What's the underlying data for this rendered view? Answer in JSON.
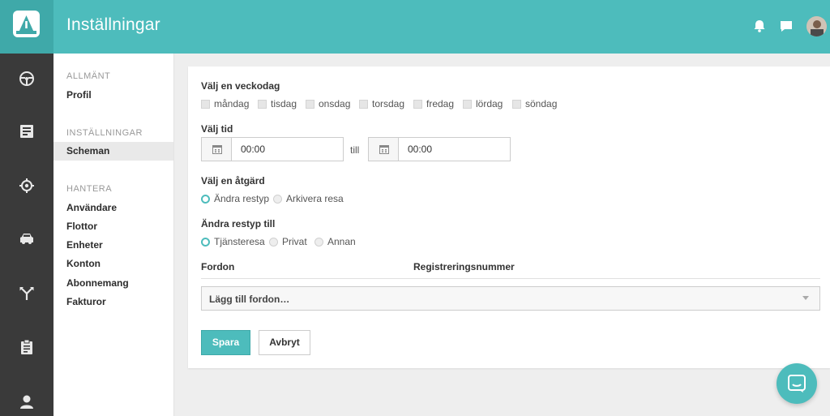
{
  "header": {
    "title": "Inställningar",
    "icons": [
      "bell-icon",
      "chat-icon"
    ],
    "accent_color": "#4dbcbc"
  },
  "rail": {
    "icons": [
      "steering-wheel-icon",
      "trip-list-icon",
      "location-icon",
      "car-icon",
      "route-split-icon",
      "clipboard-icon",
      "person-icon"
    ]
  },
  "subnav": {
    "sections": [
      {
        "heading": "ALLMÄNT",
        "items": [
          "Profil"
        ]
      },
      {
        "heading": "INSTÄLLNINGAR",
        "items": [
          "Scheman"
        ]
      },
      {
        "heading": "HANTERA",
        "items": [
          "Användare",
          "Flottor",
          "Enheter",
          "Konton",
          "Abonnemang",
          "Fakturor"
        ]
      }
    ],
    "active_item": "Scheman"
  },
  "form": {
    "weekday_label": "Välj en veckodag",
    "weekdays": [
      "måndag",
      "tisdag",
      "onsdag",
      "torsdag",
      "fredag",
      "lördag",
      "söndag"
    ],
    "time_label": "Välj tid",
    "time_from": "00:00",
    "time_sep": "till",
    "time_to": "00:00",
    "action_label": "Välj en åtgärd",
    "actions": [
      "Ändra restyp",
      "Arkivera resa"
    ],
    "action_selected": "Ändra restyp",
    "triptype_label": "Ändra restyp till",
    "triptypes": [
      "Tjänsteresa",
      "Privat",
      "Annan"
    ],
    "triptype_selected": "Tjänsteresa",
    "col_vehicle": "Fordon",
    "col_reg": "Registreringsnummer",
    "vehicle_select": "Lägg till fordon…",
    "save_label": "Spara",
    "cancel_label": "Avbryt"
  }
}
